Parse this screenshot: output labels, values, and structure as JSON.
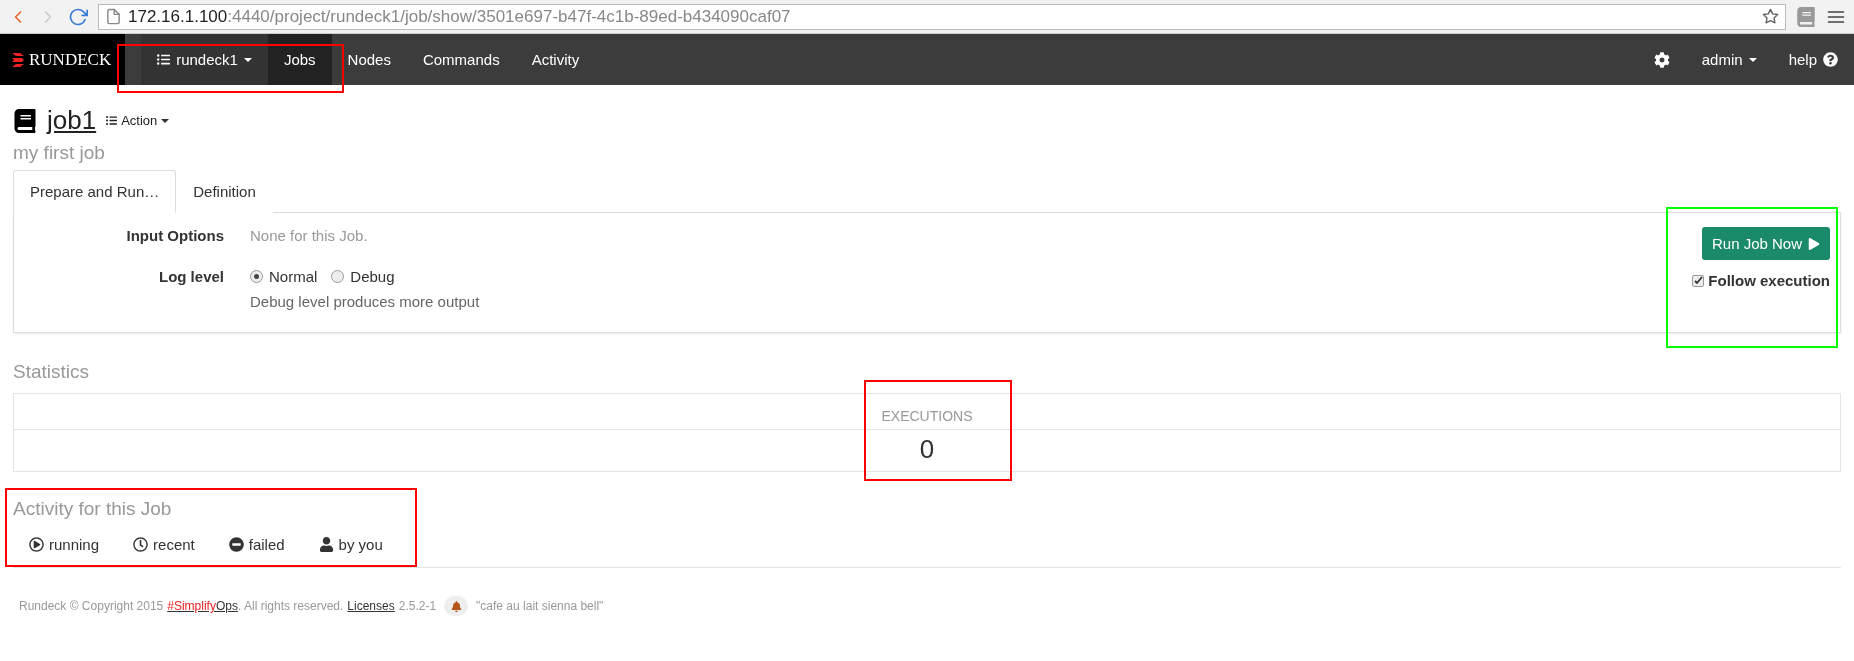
{
  "browser": {
    "url_host": "172.16.1.100",
    "url_path": ":4440/project/rundeck1/job/show/3501e697-b47f-4c1b-89ed-b434090caf07"
  },
  "navbar": {
    "brand": "RUNDECK",
    "project": "rundeck1",
    "items": [
      {
        "label": "Jobs",
        "selected": true
      },
      {
        "label": "Nodes",
        "selected": false
      },
      {
        "label": "Commands",
        "selected": false
      },
      {
        "label": "Activity",
        "selected": false
      }
    ],
    "user": "admin",
    "help": "help",
    "highlighted": true
  },
  "job": {
    "title": "job1",
    "action": "Action",
    "description": "my first job"
  },
  "tabs": [
    {
      "label": "Prepare and Run…",
      "selected": true
    },
    {
      "label": "Definition",
      "selected": false
    }
  ],
  "options": {
    "input_label": "Input Options",
    "input_value": "None for this Job.",
    "log_label": "Log level",
    "levels": [
      {
        "label": "Normal",
        "selected": true
      },
      {
        "label": "Debug",
        "selected": false
      }
    ],
    "log_hint": "Debug level produces more output"
  },
  "run": {
    "button": "Run Job Now",
    "follow": {
      "label": "Follow execution",
      "checked": true
    },
    "highlighted": true
  },
  "statistics": {
    "title": "Statistics",
    "label": "EXECUTIONS",
    "value": "0",
    "highlighted": true
  },
  "activity": {
    "title": "Activity for this Job",
    "filters": [
      {
        "label": "running",
        "kind": "play"
      },
      {
        "label": "recent",
        "kind": "clock"
      },
      {
        "label": "failed",
        "kind": "minus"
      },
      {
        "label": "by you",
        "kind": "user"
      }
    ],
    "highlighted": true
  },
  "footer": {
    "copyright": "Rundeck © Copyright 2015",
    "tag_red": "#Simplify",
    "tag_rest": "Ops",
    "reserved": ". All rights reserved.",
    "licenses": "Licenses",
    "version": "2.5.2-1",
    "motto": "\"cafe au lait sienna bell\""
  }
}
